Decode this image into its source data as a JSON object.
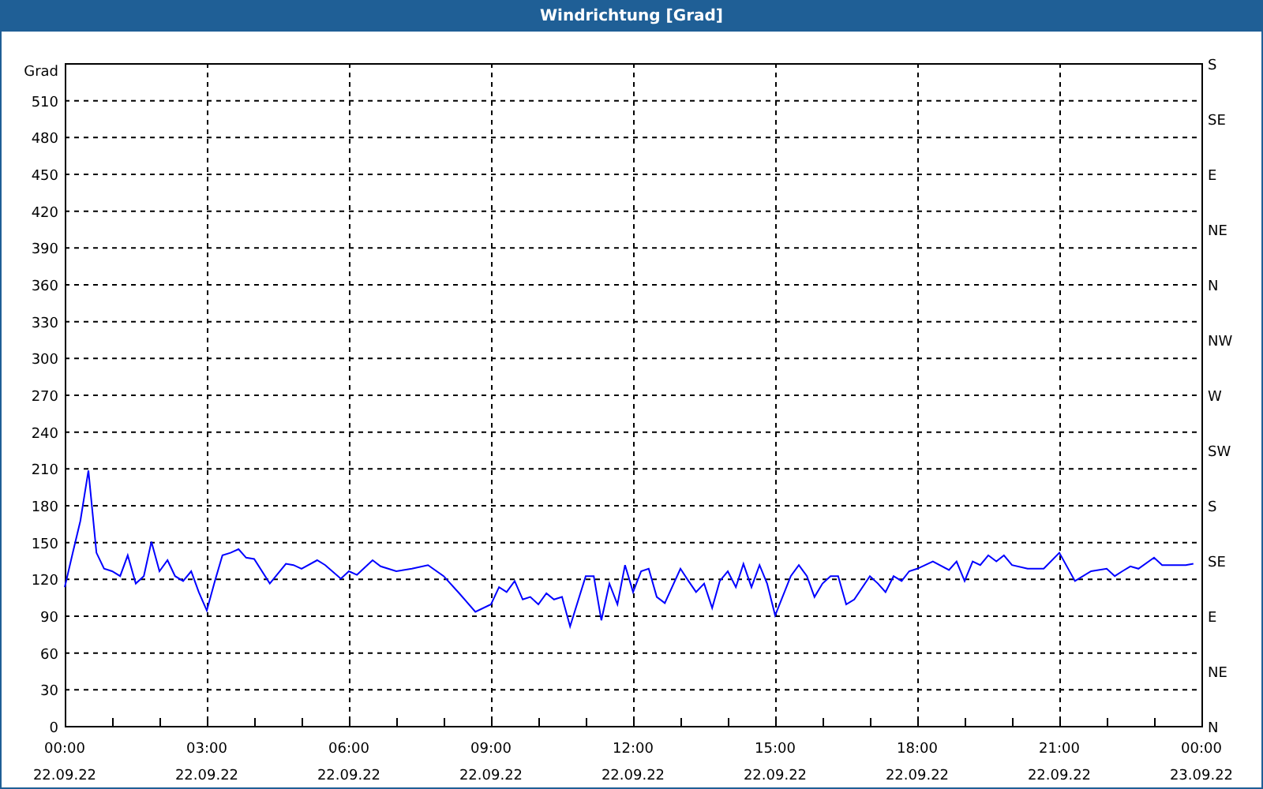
{
  "window": {
    "title": "Windrichtung [Grad]"
  },
  "chart": {
    "chart_data": {
      "type": "line",
      "ylabel": "Grad",
      "x": [
        0,
        0.17,
        0.33,
        0.5,
        0.67,
        0.83,
        1,
        1.17,
        1.33,
        1.5,
        1.67,
        1.83,
        2,
        2.17,
        2.33,
        2.5,
        2.67,
        2.83,
        3,
        3.17,
        3.33,
        3.5,
        3.67,
        3.83,
        4,
        4.33,
        4.67,
        4.83,
        5,
        5.33,
        5.5,
        5.83,
        6,
        6.17,
        6.5,
        6.67,
        7,
        7.33,
        7.67,
        8,
        8.33,
        8.67,
        9,
        9.17,
        9.33,
        9.5,
        9.67,
        9.83,
        10,
        10.17,
        10.33,
        10.5,
        10.67,
        11,
        11.17,
        11.33,
        11.5,
        11.67,
        11.83,
        12,
        12.17,
        12.33,
        12.5,
        12.67,
        13,
        13.17,
        13.33,
        13.5,
        13.67,
        13.83,
        14,
        14.17,
        14.33,
        14.5,
        14.67,
        14.83,
        15,
        15.33,
        15.5,
        15.67,
        15.83,
        16,
        16.17,
        16.33,
        16.5,
        16.67,
        17,
        17.17,
        17.33,
        17.5,
        17.67,
        17.83,
        18,
        18.33,
        18.67,
        18.83,
        19,
        19.17,
        19.33,
        19.5,
        19.67,
        19.83,
        20,
        20.33,
        20.67,
        21,
        21.33,
        21.67,
        22,
        22.17,
        22.33,
        22.5,
        22.67,
        23,
        23.17,
        23.33,
        23.67,
        23.83
      ],
      "series": [
        {
          "color": "#0000ff",
          "values": [
            113,
            141,
            167,
            208,
            141,
            128,
            126,
            122,
            139,
            116,
            122,
            150,
            126,
            135,
            122,
            118,
            126,
            109,
            94,
            118,
            139,
            141,
            144,
            137,
            136,
            116,
            132,
            131,
            128,
            135,
            131,
            120,
            126,
            123,
            135,
            130,
            126,
            128,
            131,
            122,
            108,
            93,
            99,
            113,
            109,
            118,
            103,
            105,
            99,
            108,
            103,
            105,
            81,
            122,
            122,
            86,
            116,
            99,
            131,
            109,
            126,
            128,
            105,
            100,
            128,
            118,
            109,
            116,
            96,
            118,
            126,
            113,
            132,
            113,
            131,
            116,
            90,
            122,
            131,
            122,
            105,
            116,
            122,
            122,
            99,
            103,
            122,
            116,
            109,
            122,
            118,
            126,
            128,
            134,
            127,
            134,
            118,
            134,
            131,
            139,
            134,
            139,
            131,
            128,
            128,
            141,
            118,
            126,
            128,
            122,
            126,
            130,
            128,
            137,
            131,
            131,
            131,
            132
          ]
        }
      ],
      "xlim": [
        0,
        24
      ],
      "ylim": [
        0,
        540
      ],
      "grid": true,
      "xticks": [
        {
          "value": 0,
          "label": "00:00"
        },
        {
          "value": 3,
          "label": "03:00"
        },
        {
          "value": 6,
          "label": "06:00"
        },
        {
          "value": 9,
          "label": "09:00"
        },
        {
          "value": 12,
          "label": "12:00"
        },
        {
          "value": 15,
          "label": "15:00"
        },
        {
          "value": 18,
          "label": "18:00"
        },
        {
          "value": 21,
          "label": "21:00"
        },
        {
          "value": 24,
          "label": "00:00"
        }
      ],
      "yticks": [
        0,
        30,
        60,
        90,
        120,
        150,
        180,
        210,
        240,
        270,
        300,
        330,
        360,
        390,
        420,
        450,
        480,
        510
      ]
    },
    "x_dates": [
      "22.09.22",
      "22.09.22",
      "22.09.22",
      "22.09.22",
      "22.09.22",
      "22.09.22",
      "22.09.22",
      "22.09.22",
      "23.09.22"
    ],
    "compass_axis": [
      "S",
      "SE",
      "E",
      "NE",
      "N",
      "NW",
      "W",
      "SW",
      "S",
      "SE",
      "E",
      "NE",
      "N"
    ]
  }
}
